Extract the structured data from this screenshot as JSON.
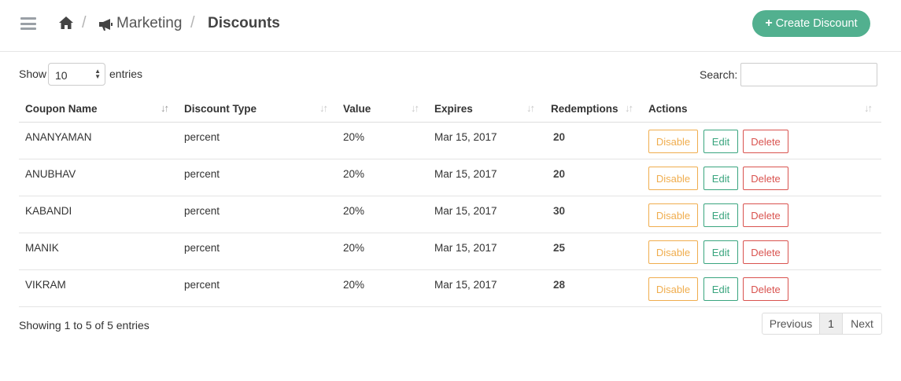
{
  "header": {
    "breadcrumb": {
      "section": "Marketing",
      "current": "Discounts"
    },
    "create_button_label": "Create Discount"
  },
  "controls": {
    "show_label": "Show",
    "entries_value": "10",
    "entries_label": "entries",
    "search_label": "Search:",
    "search_value": ""
  },
  "table": {
    "columns": [
      "Coupon Name",
      "Discount Type",
      "Value",
      "Expires",
      "Redemptions",
      "Actions"
    ],
    "rows": [
      {
        "name": "ANANYAMAN",
        "type": "percent",
        "value": "20%",
        "expires": "Mar 15, 2017",
        "redemptions": "20"
      },
      {
        "name": "ANUBHAV",
        "type": "percent",
        "value": "20%",
        "expires": "Mar 15, 2017",
        "redemptions": "20"
      },
      {
        "name": "KABANDI",
        "type": "percent",
        "value": "20%",
        "expires": "Mar 15, 2017",
        "redemptions": "30"
      },
      {
        "name": "MANIK",
        "type": "percent",
        "value": "20%",
        "expires": "Mar 15, 2017",
        "redemptions": "25"
      },
      {
        "name": "VIKRAM",
        "type": "percent",
        "value": "20%",
        "expires": "Mar 15, 2017",
        "redemptions": "28"
      }
    ],
    "actions": {
      "disable": "Disable",
      "edit": "Edit",
      "delete": "Delete"
    }
  },
  "footer": {
    "info": "Showing 1 to 5 of 5 entries",
    "prev": "Previous",
    "page": "1",
    "next": "Next"
  },
  "colors": {
    "accent": "#52b08f",
    "warning": "#f0ad4e",
    "success": "#3aa57f",
    "danger": "#d9534f"
  }
}
